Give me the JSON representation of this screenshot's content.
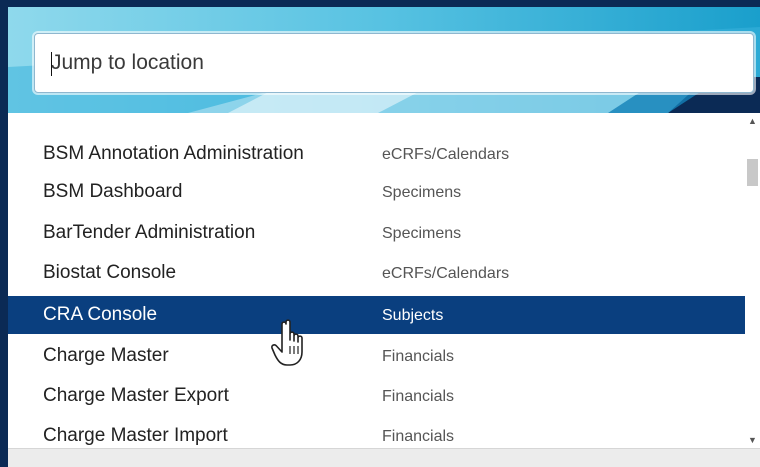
{
  "search": {
    "placeholder": "Jump to location",
    "value": ""
  },
  "list": {
    "items": [
      {
        "name": "BSM Annotation Administration",
        "category": "eCRFs/Calendars",
        "selected": false
      },
      {
        "name": "BSM Dashboard",
        "category": "Specimens",
        "selected": false
      },
      {
        "name": "BarTender Administration",
        "category": "Specimens",
        "selected": false
      },
      {
        "name": "Biostat Console",
        "category": "eCRFs/Calendars",
        "selected": false
      },
      {
        "name": "CRA Console",
        "category": "Subjects",
        "selected": true
      },
      {
        "name": "Charge Master",
        "category": "Financials",
        "selected": false
      },
      {
        "name": "Charge Master Export",
        "category": "Financials",
        "selected": false
      },
      {
        "name": "Charge Master Import",
        "category": "Financials",
        "selected": false
      }
    ]
  },
  "scrollbar": {
    "up_icon": "triangle-up",
    "down_icon": "triangle-down"
  },
  "colors": {
    "frame": "#0b2a55",
    "header_gradient_start": "#7fd3ea",
    "header_gradient_end": "#1aa3cf",
    "selected_row": "#0a3f7f"
  },
  "cursor_icon": "hand-pointer"
}
